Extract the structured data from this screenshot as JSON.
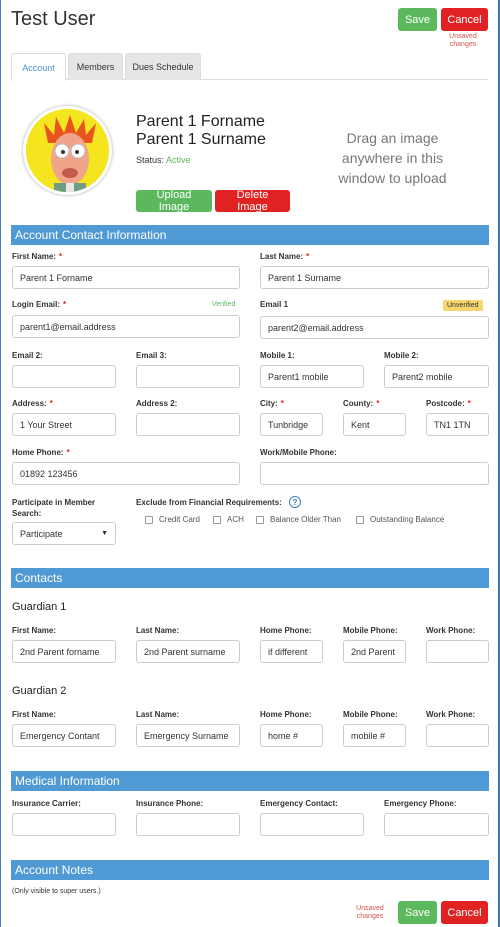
{
  "header": {
    "title": "Test User",
    "save_label": "Save",
    "cancel_label": "Cancel",
    "unsaved_text": "Unsaved changes"
  },
  "tabs": [
    {
      "label": "Account",
      "active": true
    },
    {
      "label": "Members",
      "active": false
    },
    {
      "label": "Dues Schedule",
      "active": false
    }
  ],
  "profile": {
    "forename": "Parent 1 Forname",
    "surname": "Parent 1 Surname",
    "status_label": "Status:",
    "status_value": "Active",
    "upload_label": "Upload Image",
    "delete_label": "Delete Image",
    "drag_text": "Drag an image anywhere in this window to upload"
  },
  "account_contact": {
    "heading": "Account Contact Information",
    "first_name_label": "First Name:",
    "first_name_value": "Parent 1 Forname",
    "last_name_label": "Last Name:",
    "last_name_value": "Parent 1 Surname",
    "login_email_label": "Login Email:",
    "login_email_value": "parent1@email.address",
    "verified_text": "Verified",
    "email1_label": "Email 1",
    "email1_value": "parent2@email.address",
    "unverified_text": "Unverified",
    "email2_label": "Email 2:",
    "email2_value": "",
    "email3_label": "Email 3:",
    "email3_value": "",
    "mobile1_label": "Mobile 1:",
    "mobile1_value": "Parent1 mobile",
    "mobile2_label": "Mobile 2:",
    "mobile2_value": "Parent2 mobile",
    "address_label": "Address:",
    "address_value": "1 Your Street",
    "address2_label": "Address 2:",
    "address2_value": "",
    "city_label": "City:",
    "city_value": "Tunbridge",
    "county_label": "County:",
    "county_value": "Kent",
    "postcode_label": "Postcode:",
    "postcode_value": "TN1 1TN",
    "home_phone_label": "Home Phone:",
    "home_phone_value": "01892 123456",
    "work_mobile_label": "Work/Mobile Phone:",
    "work_mobile_value": "",
    "participate_label_1": "Participate in Member",
    "participate_label_2": "Search:",
    "participate_value": "Participate",
    "exclude_label": "Exclude from Financial Requirements:",
    "checkboxes": [
      "Credit Card",
      "ACH",
      "Balance Older Than",
      "Outstanding Balance"
    ]
  },
  "contacts": {
    "heading": "Contacts",
    "guardian1": {
      "title": "Guardian 1",
      "first_name_label": "First Name:",
      "first_name_value": "2nd Parent forname",
      "last_name_label": "Last Name:",
      "last_name_value": "2nd Parent surname",
      "home_phone_label": "Home Phone:",
      "home_phone_value": "if different",
      "mobile_phone_label": "Mobile Phone:",
      "mobile_phone_value": "2nd Parent",
      "work_phone_label": "Work Phone:",
      "work_phone_value": ""
    },
    "guardian2": {
      "title": "Guardian 2",
      "first_name_label": "First Name:",
      "first_name_value": "Emergency Contant",
      "last_name_label": "Last Name:",
      "last_name_value": "Emergency Surname",
      "home_phone_label": "Home Phone:",
      "home_phone_value": "home #",
      "mobile_phone_label": "Mobile Phone:",
      "mobile_phone_value": "mobile #",
      "work_phone_label": "Work Phone:",
      "work_phone_value": ""
    }
  },
  "medical": {
    "heading": "Medical Information",
    "carrier_label": "Insurance Carrier:",
    "carrier_value": "",
    "ins_phone_label": "Insurance Phone:",
    "ins_phone_value": "",
    "em_contact_label": "Emergency Contact:",
    "em_contact_value": "",
    "em_phone_label": "Emergency Phone:",
    "em_phone_value": ""
  },
  "notes": {
    "heading": "Account Notes",
    "visibility_text": "(Only visible to super users.)"
  },
  "colors": {
    "accent": "#4f9ad4",
    "save": "#5cb85c",
    "cancel": "#e02222",
    "active_status": "#5cb85c"
  },
  "icons": [
    "avatar-muppet",
    "dropdown-caret",
    "help-icon"
  ]
}
